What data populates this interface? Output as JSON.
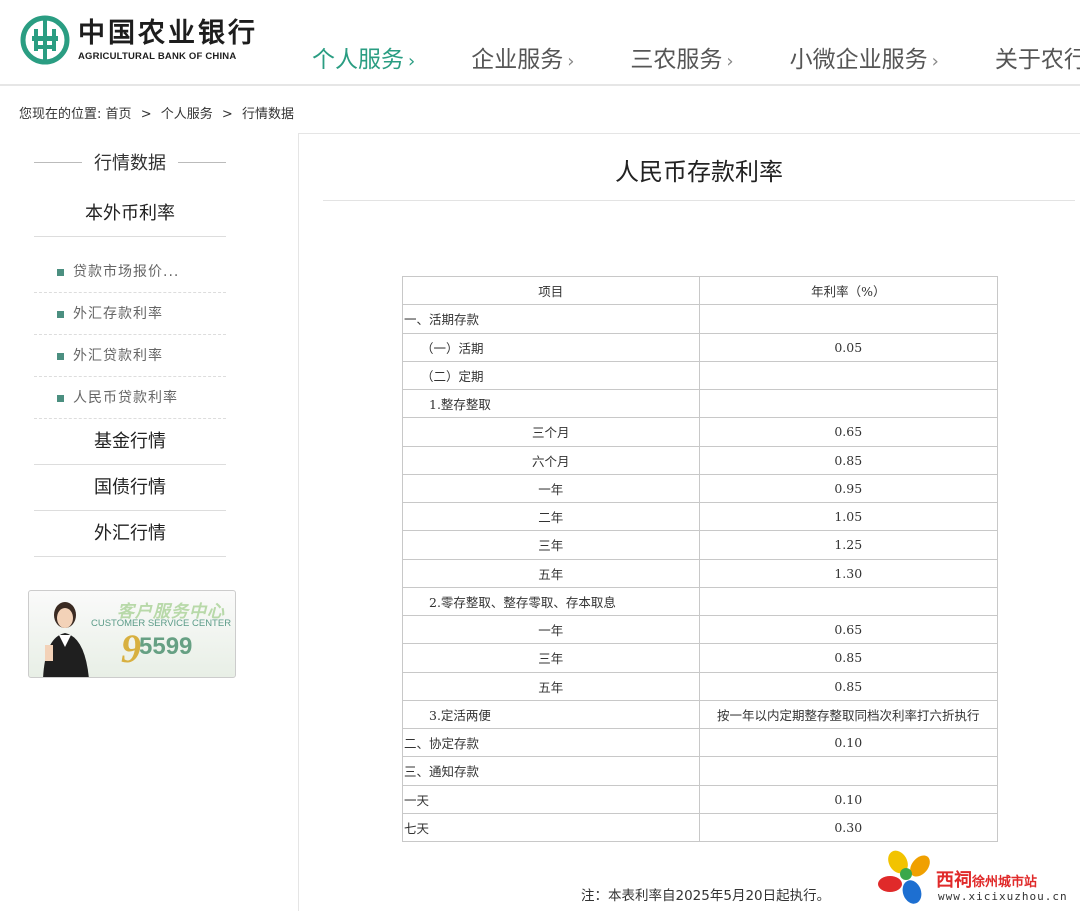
{
  "logo": {
    "cn": "中国农业银行",
    "en": "AGRICULTURAL BANK OF CHINA"
  },
  "nav": [
    {
      "label": "个人服务",
      "active": true
    },
    {
      "label": "企业服务",
      "active": false
    },
    {
      "label": "三农服务",
      "active": false
    },
    {
      "label": "小微企业服务",
      "active": false
    },
    {
      "label": "关于农行",
      "active": false
    }
  ],
  "breadcrumb": {
    "prefix": "您现在的位置:",
    "items": [
      "首页",
      "个人服务",
      "行情数据"
    ],
    "separator": ">"
  },
  "sidebar": {
    "title": "行情数据",
    "categories": {
      "rates": "本外币利率",
      "fund": "基金行情",
      "bond": "国债行情",
      "fx": "外汇行情"
    },
    "subitems": [
      "贷款市场报价...",
      "外汇存款利率",
      "外汇贷款利率",
      "人民币贷款利率"
    ]
  },
  "banner": {
    "cn": "客户服务中心",
    "en": "CUSTOMER SERVICE CENTER",
    "nine": "9",
    "number": "5599"
  },
  "main": {
    "title": "人民币存款利率",
    "table": {
      "headers": [
        "项目",
        "年利率（%）"
      ],
      "rows": [
        {
          "item": "一、活期存款",
          "rate": "",
          "level": 0
        },
        {
          "item": "（一）活期",
          "rate": "0.05",
          "level": 1
        },
        {
          "item": "（二）定期",
          "rate": "",
          "level": 1
        },
        {
          "item": "1.整存整取",
          "rate": "",
          "level": 2
        },
        {
          "item": "三个月",
          "rate": "0.65",
          "level": 3
        },
        {
          "item": "六个月",
          "rate": "0.85",
          "level": 3
        },
        {
          "item": "一年",
          "rate": "0.95",
          "level": 3
        },
        {
          "item": "二年",
          "rate": "1.05",
          "level": 3
        },
        {
          "item": "三年",
          "rate": "1.25",
          "level": 3
        },
        {
          "item": "五年",
          "rate": "1.30",
          "level": 3
        },
        {
          "item": "2.零存整取、整存零取、存本取息",
          "rate": "",
          "level": 2
        },
        {
          "item": "一年",
          "rate": "0.65",
          "level": 3
        },
        {
          "item": "三年",
          "rate": "0.85",
          "level": 3
        },
        {
          "item": "五年",
          "rate": "0.85",
          "level": 3
        },
        {
          "item": "3.定活两便",
          "rate": "按一年以内定期整存整取同档次利率打六折执行",
          "level": 2
        },
        {
          "item": "二、协定存款",
          "rate": "0.10",
          "level": 0
        },
        {
          "item": "三、通知存款",
          "rate": "",
          "level": 0
        },
        {
          "item": "一天",
          "rate": "0.10",
          "level": 0
        },
        {
          "item": "七天",
          "rate": "0.30",
          "level": 0
        }
      ]
    },
    "note": "注：本表利率自2025年5月20日起执行。"
  },
  "watermark": {
    "brand": "西祠",
    "sub": "徐州城市站",
    "url": "www.xicixuzhou.cn"
  },
  "colors": {
    "brand_green": "#2a9d82",
    "bullet": "#4b8f80"
  }
}
